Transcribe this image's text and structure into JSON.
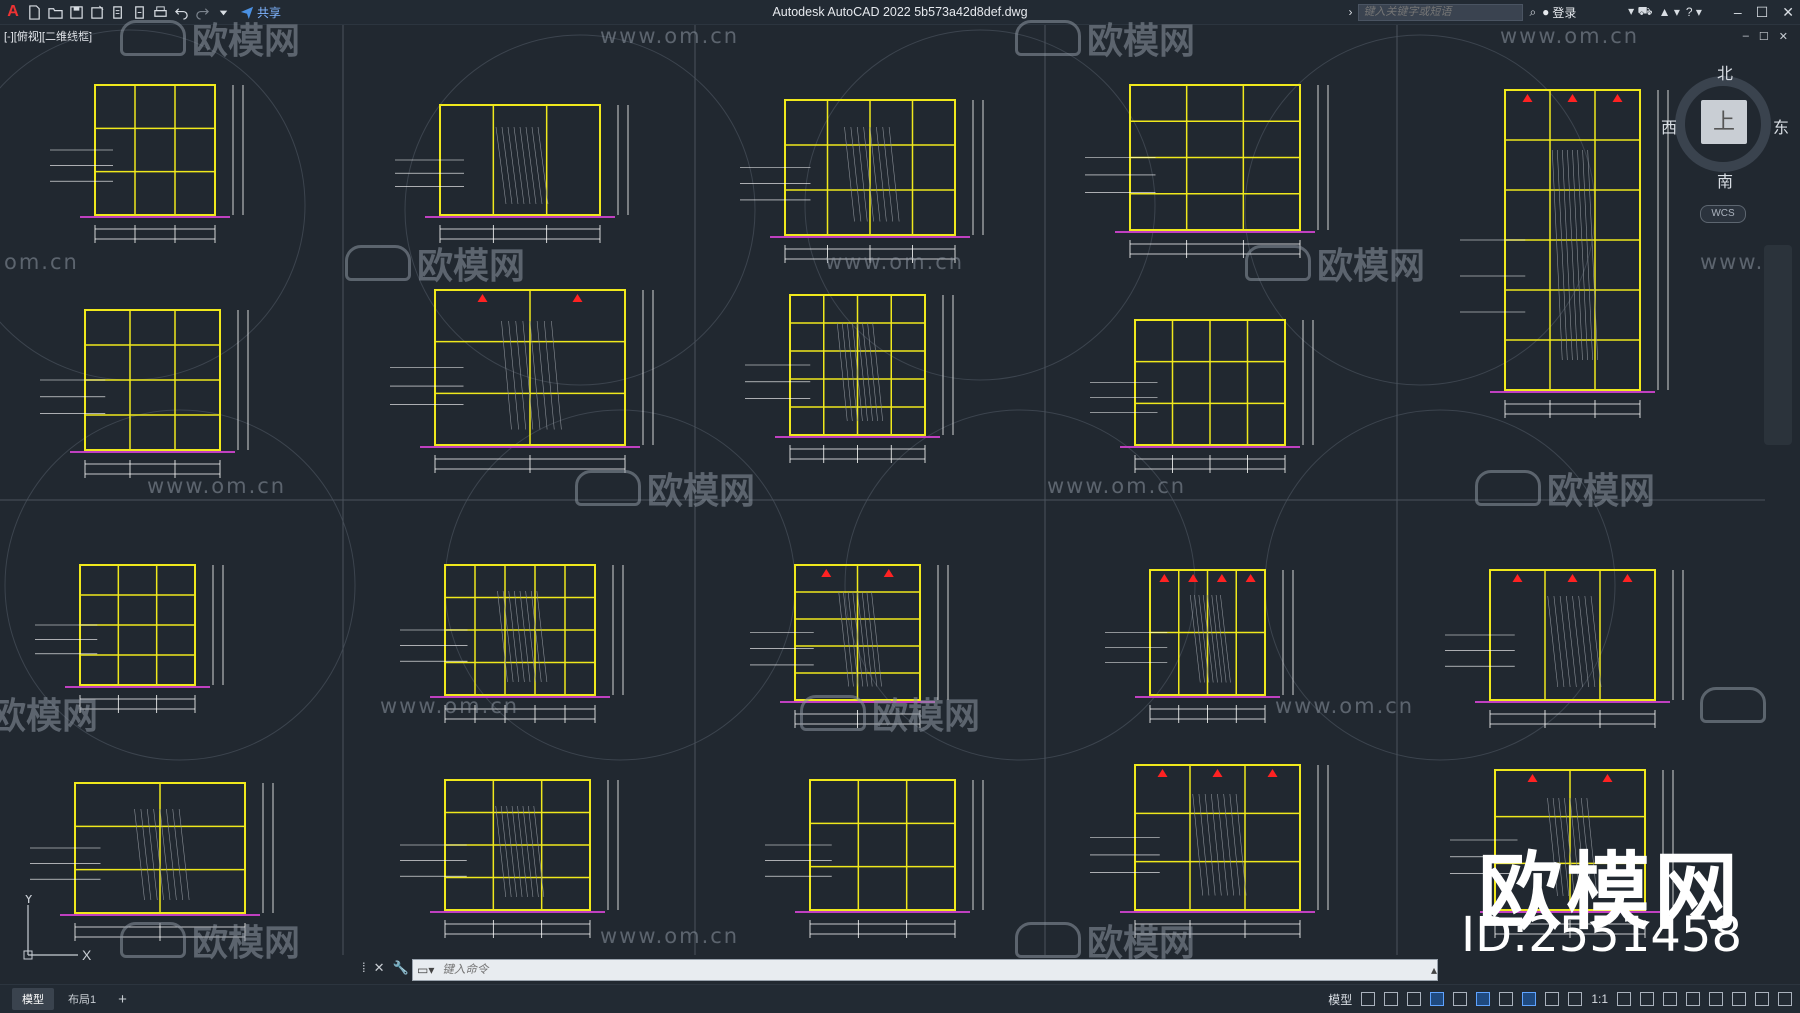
{
  "app": {
    "title": "Autodesk AutoCAD 2022    5b573a42d8def.dwg",
    "logo": "A",
    "share_label": "共享"
  },
  "toolbar": {
    "search_placeholder": "键入关键字或短语",
    "login_label": "登录",
    "icons": [
      "new-icon",
      "open-icon",
      "save-icon",
      "saveas-icon",
      "plot-icon",
      "publish-icon",
      "print-icon",
      "undo-icon",
      "redo-icon",
      "share-icon"
    ]
  },
  "window_controls": {
    "minimize": "–",
    "maximize": "☐",
    "close": "✕"
  },
  "viewport": {
    "label": "[-][俯视][二维线框]",
    "controls": [
      "–",
      "☐",
      "✕"
    ]
  },
  "viewcube": {
    "top_face": "上",
    "north": "北",
    "south": "南",
    "west": "西",
    "east": "东",
    "wcs": "WCS"
  },
  "watermarks": {
    "url": "www.om.cn",
    "brand": "欧模网",
    "url_short": "om.cn",
    "url_partial": "www."
  },
  "brand_overlay": {
    "name": "欧模网",
    "id": "ID:2551458"
  },
  "ucs": {
    "y": "Y",
    "x": "X"
  },
  "command": {
    "placeholder": "键入命令"
  },
  "layout_tabs": [
    {
      "label": "模型",
      "active": true
    },
    {
      "label": "布局1",
      "active": false
    }
  ],
  "status": {
    "model_label": "模型",
    "scale_label": "1:1"
  },
  "colors": {
    "background": "#212830",
    "drawing_lines": "#f0e81c",
    "dims": "#ffffff",
    "accent_red": "#ff2222",
    "magenta_floor": "#c040c0",
    "grid": "#4a525c"
  }
}
